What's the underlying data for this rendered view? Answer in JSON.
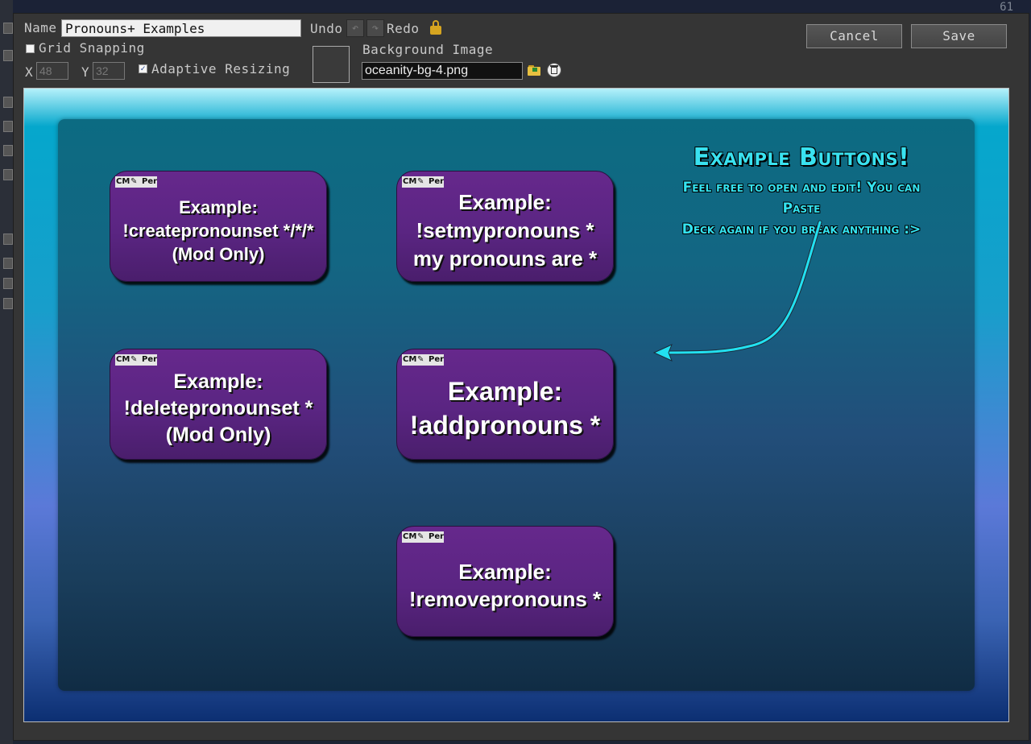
{
  "background_app": {
    "corner_number": "61"
  },
  "toolbar": {
    "name_label": "Name",
    "name_value": "Pronouns+ Examples",
    "undo_label": "Undo",
    "redo_label": "Redo",
    "grid_snapping_label": "Grid Snapping",
    "grid_snapping_checked": false,
    "x_label": "X",
    "x_value": "48",
    "y_label": "Y",
    "y_value": "32",
    "adaptive_resizing_label": "Adaptive Resizing",
    "adaptive_resizing_checked": true,
    "background_image_label": "Background Image",
    "background_image_value": "oceanity-bg-4.png",
    "cancel_label": "Cancel",
    "save_label": "Save",
    "accent_lock_color": "#d6a520"
  },
  "canvas": {
    "callout": {
      "title": "Example Buttons!",
      "line1": "Feel free to open and edit! You can Paste",
      "line2": "Deck again if you break anything :>"
    },
    "badges": {
      "a": "CM",
      "c": "Per"
    },
    "buttons": [
      {
        "lines": [
          "Example:",
          "!createpronounset */*/*",
          "(Mod Only)"
        ]
      },
      {
        "lines": [
          "Example:",
          "!setmypronouns *",
          "my pronouns are *"
        ]
      },
      {
        "lines": [
          "Example:",
          "!deletepronounset *",
          "(Mod Only)"
        ]
      },
      {
        "lines": [
          "Example:",
          "!addpronouns *"
        ]
      },
      {
        "lines": [
          "Example:",
          "!removepronouns *"
        ]
      }
    ],
    "colors": {
      "button_fill": "#5a2582",
      "callout_text": "#39e2f0",
      "arrow": "#22e0f0"
    }
  }
}
